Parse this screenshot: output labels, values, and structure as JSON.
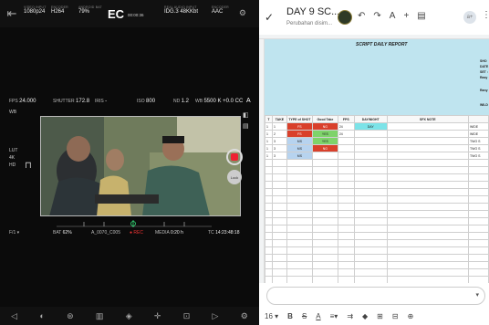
{
  "camera": {
    "top": [
      {
        "label": "VIDEO INPUT",
        "value": "1080p24"
      },
      {
        "label": "ENCODER",
        "value": "H264"
      },
      {
        "label": "ANDROID BAT",
        "value": "79%"
      },
      {
        "label": "REAL AUDIO INPUT",
        "value": "IDG.3 48KKbt"
      },
      {
        "label": "ENCODER",
        "value": "AAC"
      }
    ],
    "ec": "EC",
    "timecode": "00:00:36",
    "exposure": {
      "fps_label": "FPS",
      "fps": "24.000",
      "shutter_label": "SHUTTER",
      "shutter": "172.8",
      "iris_label": "IRIS",
      "iris": "-",
      "iso_label": "ISO",
      "iso": "800",
      "nd_label": "ND",
      "nd": "1.2",
      "wb_label": "WB",
      "wb": "5500 K +0.0 CC",
      "mode": "A"
    },
    "side_left": [
      "WB",
      "LUT",
      "4K",
      "HD"
    ],
    "lock_label": "Lock",
    "bottom": {
      "f_label": "F/1 ▾",
      "bat_label": "BAT",
      "bat": "62%",
      "clip": "A_0070_C005",
      "rec_label": "● REC",
      "media_label": "MEDIA",
      "media": "0:20 h",
      "tc_label": "TC",
      "tc": "14:23:48:18"
    }
  },
  "sheet": {
    "title": "DAY 9 SC...",
    "subtitle": "Perubahan disim...",
    "share_label": "a+",
    "report_title": "SCRIPT DAILY REPORT",
    "report_info": [
      "SHO",
      "DATE",
      "SET :",
      "Rasy",
      "Rany",
      "WILD"
    ],
    "headers": [
      "T",
      "TAKE",
      "TYPE of SHOT",
      "Good Take",
      "FPS",
      "DAY/NIGHT",
      "SFX NOTE",
      ""
    ],
    "rows": [
      [
        "1",
        "1",
        "FS",
        "NG",
        "24",
        "DAY",
        "",
        "WIDE"
      ],
      [
        "1",
        "2",
        "FS",
        "YES",
        "24",
        "",
        "",
        "WIDE"
      ],
      [
        "1",
        "3",
        "MS",
        "YES",
        "",
        "",
        "",
        "TWO S"
      ],
      [
        "1",
        "3",
        "MS",
        "NG",
        "",
        "",
        "",
        "TWO S"
      ],
      [
        "1",
        "3",
        "MS",
        "",
        "",
        "",
        "",
        "TWO S"
      ]
    ],
    "font_size": "16",
    "accent": "#7ed36a"
  }
}
